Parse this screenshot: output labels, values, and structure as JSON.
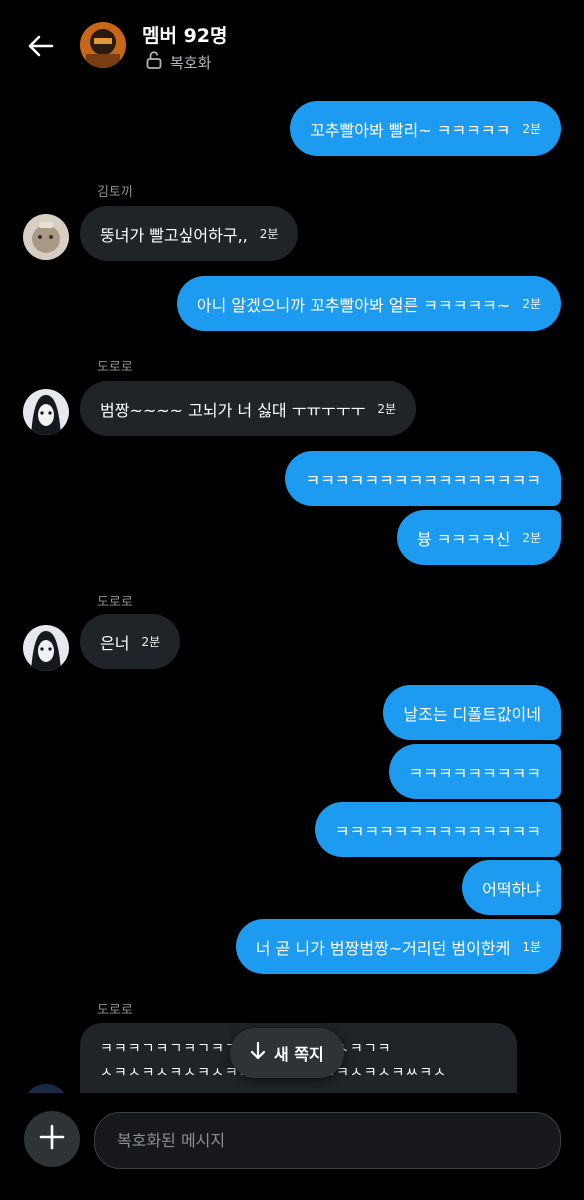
{
  "header": {
    "title": "멤버 92명",
    "subtitle": "복호화"
  },
  "messages": [
    {
      "text": "꼬추빨아봐 빨리~ ㅋㅋㅋㅋㅋ",
      "time": "2분"
    },
    {
      "sender": "김토끼",
      "text": "뚱녀가 빨고싶어하구,,",
      "time": "2분"
    },
    {
      "text": "아니 알겠으니까 꼬추빨아봐 얼른 ㅋㅋㅋㅋㅋ~",
      "time": "2분"
    },
    {
      "sender": "도로로",
      "text": "범짱~~~~ 고뇌가 너 싫대 ㅜㅠㅜㅜㅜ",
      "time": "2분"
    },
    {
      "text": "ㅋㅋㅋㅋㅋㅋㅋㅋㅋㅋㅋㅋㅋㅋㅋㅋ"
    },
    {
      "text": "븅 ㅋㅋㅋㅋ신",
      "time": "2분"
    },
    {
      "sender": "도로로",
      "text": "은너",
      "time": "2분"
    },
    {
      "text": "날조는 디폴트값이네"
    },
    {
      "text": "ㅋㅋㅋㅋㅋㅋㅋㅋㅋ"
    },
    {
      "text": "ㅋㅋㅋㅋㅋㅋㅋㅋㅋㅋㅋㅋㅋㅋ"
    },
    {
      "text": "어떡하냐"
    },
    {
      "text": "너 곧 니가 범짱범짱~거리던 범이한케",
      "time": "1분"
    },
    {
      "sender": "도로로",
      "lines": [
        "ㅋㅋㅋㄱㅋㄱㅋㄱㅋㄱㅋㅋㄱㅋㄱㄱㅋㅅㅋㄱㅋ",
        "ㅅㅋㅅㅋㅅㅋㅅㅋㅅㅋㅅㅋㅅㅋㅅㅋㅅㅋㅅㅋㅅㅋㅆㅋㅅ"
      ]
    }
  ],
  "new_message_label": "새 쪽지",
  "composer": {
    "placeholder": "복호화된 메시지"
  },
  "colors": {
    "sent_bubble": "#1d9bf0",
    "received_bubble": "#202327",
    "background": "#000000"
  }
}
